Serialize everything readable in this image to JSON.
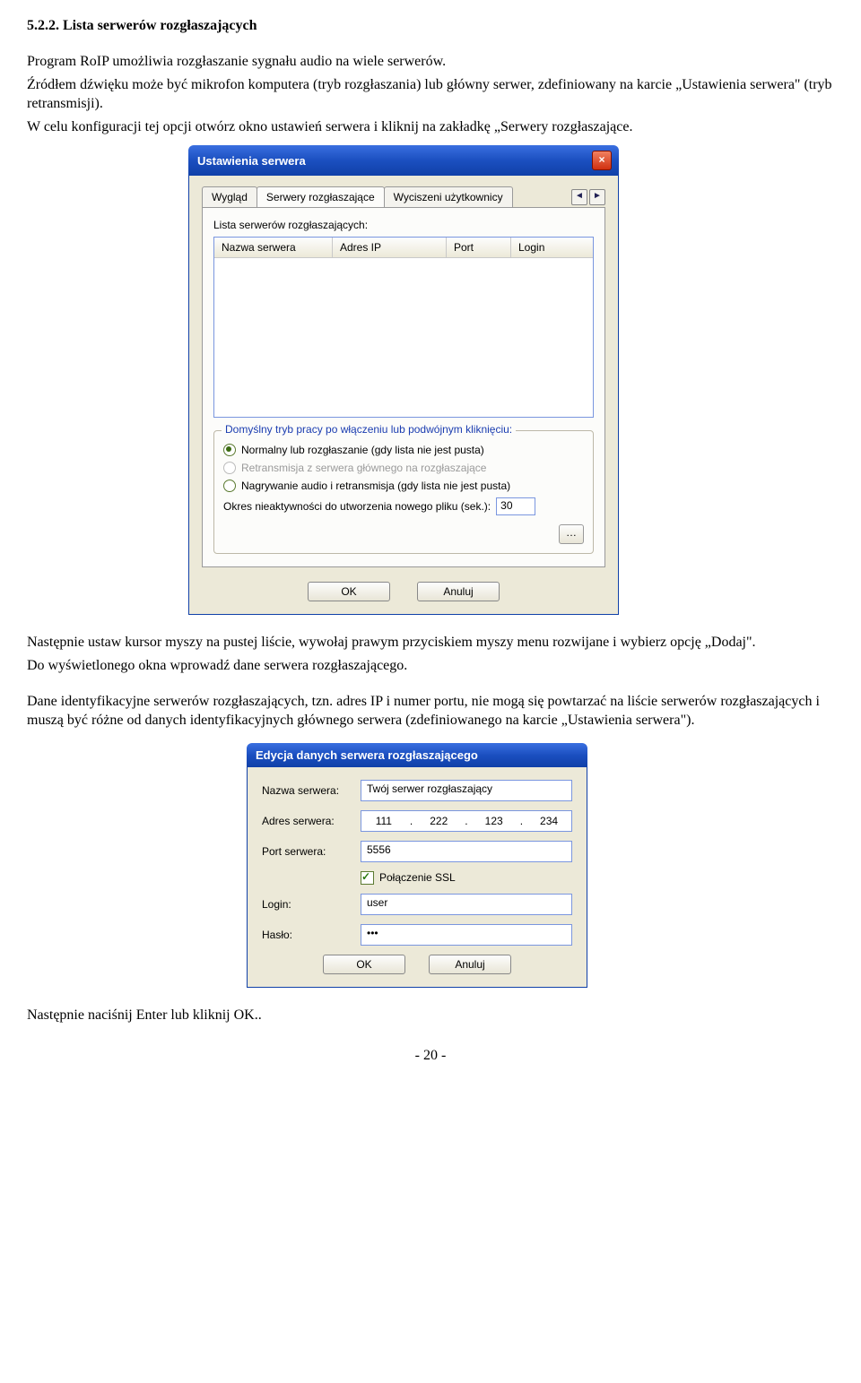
{
  "heading": "5.2.2.   Lista serwerów rozgłaszających",
  "p1": "Program RoIP umożliwia rozgłaszanie sygnału audio na wiele serwerów.",
  "p2": "Źródłem dźwięku może być mikrofon komputera (tryb rozgłaszania) lub główny serwer, zdefiniowany na karcie „Ustawienia serwera\" (tryb retransmisji).",
  "p3": "W celu konfiguracji tej opcji otwórz okno ustawień serwera i kliknij na zakładkę „Serwery rozgłaszające.",
  "p4": "Następnie ustaw kursor myszy na pustej liście, wywołaj prawym przyciskiem myszy menu rozwijane i wybierz opcję „Dodaj\".",
  "p5": "Do wyświetlonego okna wprowadź dane serwera rozgłaszającego.",
  "p6": "Dane identyfikacyjne serwerów rozgłaszających, tzn. adres IP i numer portu, nie mogą się powtarzać na liście serwerów rozgłaszających i muszą być różne od danych identyfikacyjnych głównego serwera (zdefiniowanego na karcie „Ustawienia serwera\").",
  "p7": "Następnie naciśnij Enter lub kliknij OK..",
  "dlg1": {
    "title": "Ustawienia serwera",
    "tabs": [
      "Wygląd",
      "Serwery rozgłaszające",
      "Wyciszeni użytkownicy"
    ],
    "listlabel": "Lista serwerów rozgłaszających:",
    "cols": [
      "Nazwa serwera",
      "Adres IP",
      "Port",
      "Login"
    ],
    "group2title": "Domyślny tryb pracy po włączeniu lub podwójnym kliknięciu:",
    "radio1": "Normalny lub rozgłaszanie (gdy lista nie jest pusta)",
    "radio2": "Retransmisja z serwera głównego na rozgłaszające",
    "radio3": "Nagrywanie audio i retransmisja (gdy lista nie jest pusta)",
    "inactivity_label": "Okres nieaktywności do utworzenia nowego pliku (sek.):",
    "inactivity_value": "30",
    "ok": "OK",
    "cancel": "Anuluj"
  },
  "dlg2": {
    "title": "Edycja danych serwera rozgłaszającego",
    "name_label": "Nazwa serwera:",
    "name_value": "Twój serwer rozgłaszający",
    "addr_label": "Adres serwera:",
    "ip": [
      "111",
      "222",
      "123",
      "234"
    ],
    "port_label": "Port serwera:",
    "port_value": "5556",
    "ssl_label": "Połączenie SSL",
    "login_label": "Login:",
    "login_value": "user",
    "pass_label": "Hasło:",
    "pass_value": "•••",
    "ok": "OK",
    "cancel": "Anuluj"
  },
  "page_number": "- 20 -"
}
